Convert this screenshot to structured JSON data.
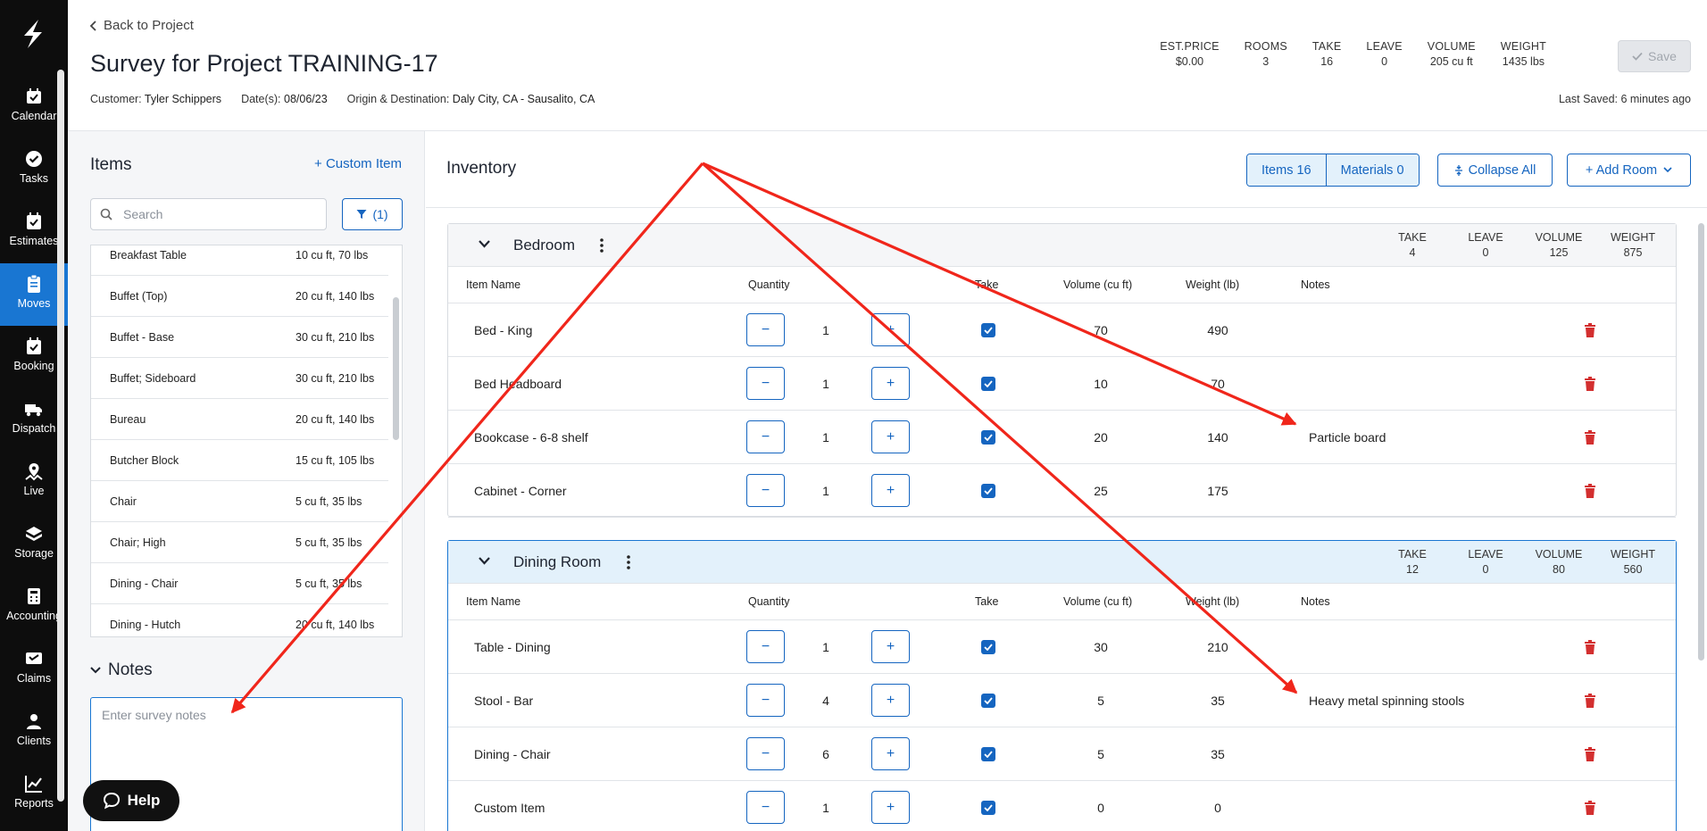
{
  "nav": {
    "items": [
      {
        "label": "Calendar",
        "icon": "calendar-icon"
      },
      {
        "label": "Tasks",
        "icon": "check-circle-icon"
      },
      {
        "label": "Estimates",
        "icon": "estimates-icon"
      },
      {
        "label": "Moves",
        "icon": "clipboard-icon"
      },
      {
        "label": "Booking",
        "icon": "booking-icon"
      },
      {
        "label": "Dispatch",
        "icon": "truck-icon"
      },
      {
        "label": "Live",
        "icon": "map-icon"
      },
      {
        "label": "Storage",
        "icon": "storage-icon"
      },
      {
        "label": "Accounting",
        "icon": "calculator-icon"
      },
      {
        "label": "Claims",
        "icon": "claims-icon"
      },
      {
        "label": "Clients",
        "icon": "person-icon"
      },
      {
        "label": "Reports",
        "icon": "chart-icon"
      }
    ],
    "active": "Moves"
  },
  "header": {
    "back_label": "Back to Project",
    "title": "Survey for Project TRAINING-17",
    "customer_label": "Customer:",
    "customer": "Tyler Schippers",
    "dates_label": "Date(s):",
    "dates": "08/06/23",
    "origin_label": "Origin & Destination:",
    "origin": "Daly City, CA - Sausalito, CA",
    "stats": [
      {
        "key": "EST.PRICE",
        "value": "$0.00"
      },
      {
        "key": "ROOMS",
        "value": "3"
      },
      {
        "key": "TAKE",
        "value": "16"
      },
      {
        "key": "LEAVE",
        "value": "0"
      },
      {
        "key": "VOLUME",
        "value": "205 cu ft"
      },
      {
        "key": "WEIGHT",
        "value": "1435 lbs"
      }
    ],
    "save_label": "Save",
    "last_saved": "Last Saved: 6 minutes ago"
  },
  "items_panel": {
    "title": "Items",
    "custom_item": "+ Custom Item",
    "search_placeholder": "Search",
    "filter_label": "(1)",
    "items": [
      {
        "name": "Breakfast Table",
        "spec": "10 cu ft, 70 lbs"
      },
      {
        "name": "Buffet (Top)",
        "spec": "20 cu ft, 140 lbs"
      },
      {
        "name": "Buffet - Base",
        "spec": "30 cu ft, 210 lbs"
      },
      {
        "name": "Buffet; Sideboard",
        "spec": "30 cu ft, 210 lbs"
      },
      {
        "name": "Bureau",
        "spec": "20 cu ft, 140 lbs"
      },
      {
        "name": "Butcher Block",
        "spec": "15 cu ft, 105 lbs"
      },
      {
        "name": "Chair",
        "spec": "5 cu ft, 35 lbs"
      },
      {
        "name": "Chair; High",
        "spec": "5 cu ft, 35 lbs"
      },
      {
        "name": "Dining - Chair",
        "spec": "5 cu ft, 35 lbs"
      },
      {
        "name": "Dining - Hutch",
        "spec": "20 cu ft, 140 lbs"
      }
    ],
    "notes_title": "Notes",
    "notes_placeholder": "Enter survey notes"
  },
  "help_label": "Help",
  "inventory": {
    "title": "Inventory",
    "tab_items": "Items 16",
    "tab_materials": "Materials 0",
    "collapse_label": "Collapse All",
    "add_room_label": "+ Add Room",
    "columns": {
      "name": "Item Name",
      "quantity": "Quantity",
      "take": "Take",
      "volume": "Volume (cu ft)",
      "weight": "Weight (lb)",
      "notes": "Notes"
    },
    "stat_keys": {
      "take": "TAKE",
      "leave": "LEAVE",
      "volume": "VOLUME",
      "weight": "WEIGHT"
    },
    "rooms": [
      {
        "name": "Bedroom",
        "take": "4",
        "leave": "0",
        "volume": "125",
        "weight": "875",
        "rows": [
          {
            "name": "Bed - King",
            "qty": "1",
            "volume": "70",
            "weight": "490",
            "notes": ""
          },
          {
            "name": "Bed Headboard",
            "qty": "1",
            "volume": "10",
            "weight": "70",
            "notes": ""
          },
          {
            "name": "Bookcase - 6-8 shelf",
            "qty": "1",
            "volume": "20",
            "weight": "140",
            "notes": "Particle board"
          },
          {
            "name": "Cabinet - Corner",
            "qty": "1",
            "volume": "25",
            "weight": "175",
            "notes": ""
          }
        ]
      },
      {
        "name": "Dining Room",
        "take": "12",
        "leave": "0",
        "volume": "80",
        "weight": "560",
        "rows": [
          {
            "name": "Table - Dining",
            "qty": "1",
            "volume": "30",
            "weight": "210",
            "notes": ""
          },
          {
            "name": "Stool - Bar",
            "qty": "4",
            "volume": "5",
            "weight": "35",
            "notes": "Heavy metal spinning stools"
          },
          {
            "name": "Dining - Chair",
            "qty": "6",
            "volume": "5",
            "weight": "35",
            "notes": ""
          },
          {
            "name": "Custom Item",
            "qty": "1",
            "volume": "0",
            "weight": "0",
            "notes": ""
          }
        ]
      }
    ]
  },
  "colors": {
    "accent": "#1565c0",
    "nav_bg": "#0d0d0d",
    "nav_active": "#1976d2",
    "delete": "#d32f2f",
    "annotation": "#f0261b"
  }
}
